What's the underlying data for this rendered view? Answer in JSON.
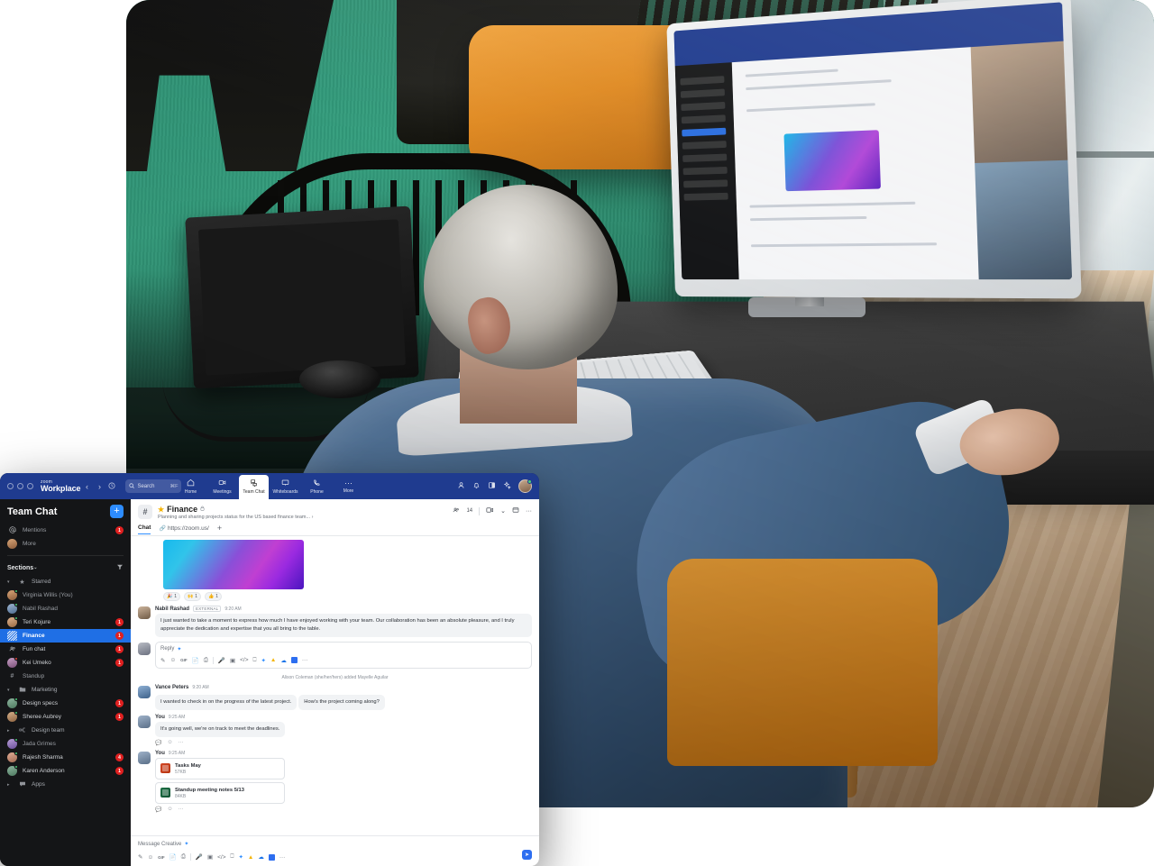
{
  "titlebar": {
    "brand_small": "zoom",
    "brand_main": "Workplace",
    "back_arrow": "‹",
    "forward_arrow": "›",
    "history_icon": "ὕ0",
    "search_icon": "search-icon",
    "search_placeholder": "Search",
    "search_shortcut": "⌘F",
    "nav": [
      {
        "label": "Home",
        "icon": "home-icon"
      },
      {
        "label": "Meetings",
        "icon": "video-camera-icon"
      },
      {
        "label": "Team Chat",
        "icon": "chat-bubble-icon"
      },
      {
        "label": "Whiteboards",
        "icon": "whiteboard-icon"
      },
      {
        "label": "Phone",
        "icon": "phone-icon"
      },
      {
        "label": "More",
        "icon": "ellipsis-icon"
      }
    ],
    "active_nav": "Team Chat",
    "right_icons": [
      "contacts-icon",
      "bell-icon",
      "theme-contrast-icon",
      "ai-sparkle-icon"
    ],
    "avatar": "user-avatar",
    "presence": "available"
  },
  "sidebar": {
    "title": "Team Chat",
    "add_button": "+",
    "top_items": [
      {
        "label": "Mentions",
        "icon": "at-mention-icon",
        "badge": "1"
      },
      {
        "label": "More",
        "icon": "more-avatar-icon",
        "badge": ""
      }
    ],
    "sections_label": "Sections",
    "sections_caret": "⌄",
    "filter_icon": "filter-icon",
    "groups": [
      {
        "name": "Starred",
        "icon": "star-icon",
        "expanded": true,
        "items": [
          {
            "label": "Virginia Willis (You)",
            "type": "dm",
            "avatar": "a1",
            "presence": "available",
            "badge": ""
          },
          {
            "label": "Nabil Rashad",
            "type": "dm",
            "avatar": "a2",
            "presence": "available",
            "badge": ""
          },
          {
            "label": "Teri Kojure",
            "type": "dm",
            "avatar": "a3",
            "presence": "available",
            "badge": "1"
          },
          {
            "label": "Finance",
            "type": "channel",
            "selected": true,
            "badge": "1"
          },
          {
            "label": "Fun chat",
            "type": "group",
            "badge": "1"
          },
          {
            "label": "Kei Umeko",
            "type": "dm",
            "avatar": "a4",
            "presence": "busy",
            "badge": "1"
          },
          {
            "label": "Standup",
            "type": "hash",
            "badge": ""
          }
        ]
      },
      {
        "name": "Marketing",
        "icon": "folder-icon",
        "expanded": true,
        "items": [
          {
            "label": "Design specs",
            "type": "dm",
            "avatar": "a5",
            "presence": "available",
            "badge": "1"
          },
          {
            "label": "Sheree Aubrey",
            "type": "dm",
            "avatar": "a6",
            "presence": "available",
            "badge": "1"
          }
        ]
      },
      {
        "name": "Design team",
        "icon": "org-chart-icon",
        "expanded": false,
        "items": [
          {
            "label": "Jada Grimes",
            "type": "dm",
            "avatar": "a7",
            "presence": "available",
            "badge": ""
          },
          {
            "label": "Rajesh Sharma",
            "type": "dm",
            "avatar": "a8",
            "presence": "available",
            "badge": "4"
          },
          {
            "label": "Karen Anderson",
            "type": "dm",
            "avatar": "a5",
            "presence": "available",
            "badge": "1"
          }
        ]
      },
      {
        "name": "Apps",
        "icon": "apps-icon",
        "expanded": false,
        "items": []
      }
    ]
  },
  "channel": {
    "hash_icon": "#",
    "star_icon": "★",
    "name": "Finance",
    "lock_icon": "lock-icon",
    "description": "Planning and sharing projects status for the US based finance team...",
    "description_caret": "›",
    "member_icon": "members-icon",
    "member_count": "14",
    "meet_icon": "video-camera-icon",
    "meet_caret": "⌄",
    "files_icon": "folder-icon",
    "more_icon": "···",
    "tabs": [
      {
        "label": "Chat",
        "active": true,
        "icon": ""
      },
      {
        "label": "https://zoom.us/",
        "active": false,
        "icon": "link-icon"
      }
    ],
    "tab_add": "+"
  },
  "messages": {
    "image_attachment": "gradient-image-attachment",
    "reactions": [
      {
        "emoji": "🎉",
        "count": "1"
      },
      {
        "emoji": "🙌",
        "count": "1"
      },
      {
        "emoji": "👍",
        "count": "1"
      }
    ],
    "items": [
      {
        "author": "Nabil Rashad",
        "external_tag": "EXTERNAL",
        "time": "9:20 AM",
        "text": "I just wanted to take a moment to express how much I have enjoyed working with your team. Our collaboration has been an absolute pleasure, and I truly appreciate the dedication and expertise that you all bring to the table."
      },
      {
        "author": "Vance Peters",
        "external_tag": "",
        "time": "9:20 AM",
        "text": "I wanted to check in on the progress of the latest project.",
        "text2": "How's the project coming along?"
      },
      {
        "author": "You",
        "external_tag": "",
        "time": "9:25 AM",
        "text": "It's going well, we're on track to meet the deadlines."
      }
    ],
    "reply_placeholder": "Reply",
    "system_message": "Alison Coleman (she/her/hers) added Mayelle Aguilar",
    "files_message": {
      "author": "You",
      "time": "9:25 AM",
      "files": [
        {
          "name": "Tasks May",
          "size": "57KB",
          "type": "ppt"
        },
        {
          "name": "Standup meeting notes 5/13",
          "size": "84KB",
          "type": "xls"
        }
      ]
    },
    "action_icons": [
      "reply-icon",
      "react-emoji-icon",
      "more-actions-icon"
    ]
  },
  "composer": {
    "placeholder": "Message Creative",
    "ai_icon": "ai-sparkle-icon",
    "tools": [
      "format-text-icon",
      "emoji-icon",
      "gif-icon",
      "file-icon",
      "screenshot-icon",
      "audio-message-icon",
      "video-message-icon",
      "code-snippet-icon",
      "screen-share-icon",
      "zoom-apps-icon",
      "google-drive-icon",
      "onedrive-icon",
      "box-icon",
      "more-tools-icon"
    ],
    "send_icon": "send-icon"
  },
  "colors": {
    "brand_blue": "#2d8cff",
    "titlebar_blue": "#1f3b8f",
    "selected_blue": "#1f6fe5",
    "badge_red": "#e02020",
    "presence_green": "#4ad07a",
    "sidebar_bg": "#141517",
    "star_gold": "#f5b301"
  }
}
